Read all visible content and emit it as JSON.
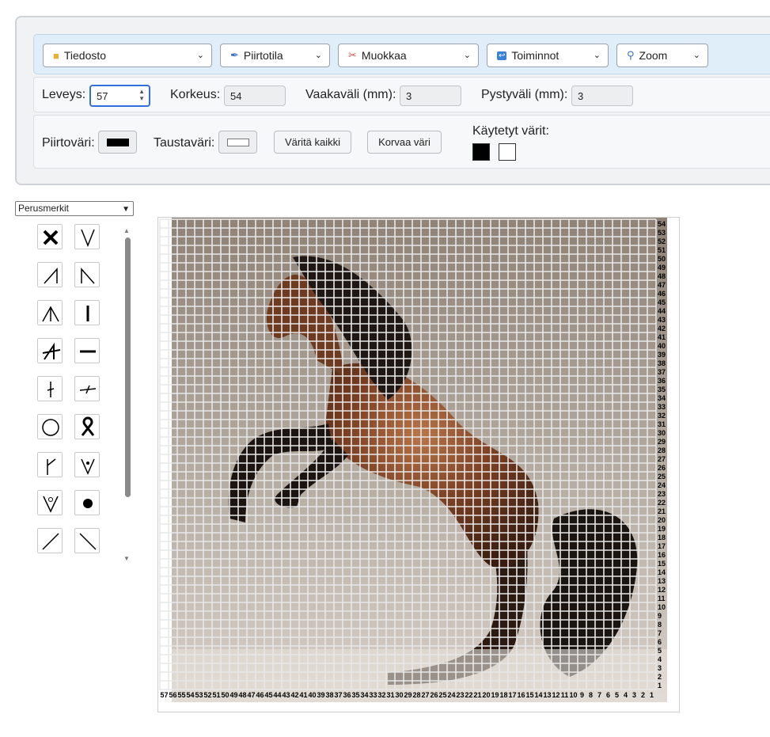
{
  "menu": [
    {
      "label": "Tiedosto",
      "icon": "folder-icon"
    },
    {
      "label": "Piirtotila",
      "icon": "pen-icon"
    },
    {
      "label": "Muokkaa",
      "icon": "scissors-icon"
    },
    {
      "label": "Toiminnot",
      "icon": "undo-arrow-icon"
    },
    {
      "label": "Zoom",
      "icon": "magnifier-icon"
    }
  ],
  "dimensions": {
    "width_label": "Leveys:",
    "width_value": "57",
    "height_label": "Korkeus:",
    "height_value": "54",
    "hspacing_label": "Vaakaväli (mm):",
    "hspacing_value": "3",
    "vspacing_label": "Pystyväli (mm):",
    "vspacing_value": "3"
  },
  "colors": {
    "draw_label": "Piirtoväri:",
    "draw_color": "#000000",
    "bg_label": "Taustaväri:",
    "bg_color": "#ffffff",
    "fill_all_button": "Väritä kaikki",
    "replace_button": "Korvaa väri",
    "used_label": "Käytetyt värit:",
    "used_colors": [
      "#000000",
      "#ffffff"
    ]
  },
  "symbol_panel": {
    "set_label": "Perusmerkit",
    "symbols": [
      "x-cross-icon",
      "v-shape-icon",
      "slash-corner-icon",
      "backslash-corner-icon",
      "arrow-up-lines-icon",
      "vertical-line-icon",
      "a-crossed-icon",
      "horizontal-line-icon",
      "vertical-tick-icon",
      "horizontal-tick-icon",
      "circle-icon",
      "ribbon-icon",
      "y-branch-icon",
      "v-dot-icon",
      "v-circle-icon",
      "filled-dot-icon",
      "diagonal-slash-icon",
      "diagonal-backslash-icon"
    ]
  },
  "grid": {
    "columns": 57,
    "rows": 54,
    "image": "rearing brown horse photo"
  }
}
